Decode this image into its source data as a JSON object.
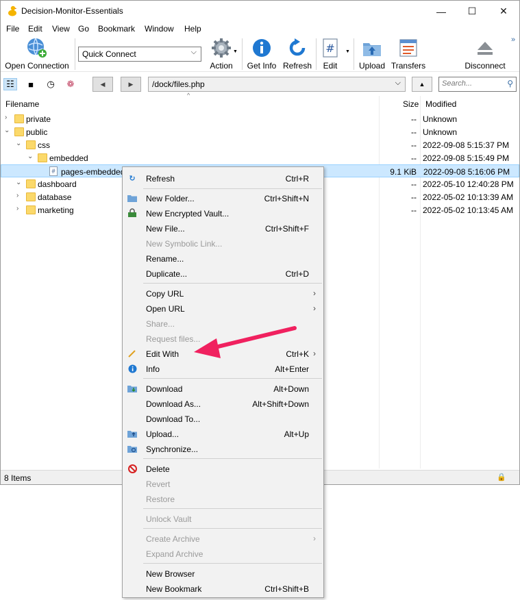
{
  "window": {
    "title": "Decision-Monitor-Essentials",
    "controls": {
      "minimize": "—",
      "maximize": "☐",
      "close": "✕"
    }
  },
  "menu": [
    "File",
    "Edit",
    "View",
    "Go",
    "Bookmark",
    "Window",
    "Help"
  ],
  "toolbar": {
    "open_connection": "Open Connection",
    "quick_connect": "Quick Connect",
    "action": "Action",
    "get_info": "Get Info",
    "refresh": "Refresh",
    "edit": "Edit",
    "upload": "Upload",
    "transfers": "Transfers",
    "disconnect": "Disconnect",
    "overflow": "»"
  },
  "nav": {
    "path": "/dock/files.php",
    "search_placeholder": "Search..."
  },
  "columns": {
    "filename": "Filename",
    "size": "Size",
    "modified": "Modified"
  },
  "files": [
    {
      "name": "private",
      "size": "--",
      "modified": "Unknown",
      "type": "folder",
      "expanded": false
    },
    {
      "name": "public",
      "size": "--",
      "modified": "Unknown",
      "type": "folder",
      "expanded": true
    },
    {
      "name": "css",
      "size": "--",
      "modified": "2022-09-08 5:15:37 PM",
      "type": "folder",
      "expanded": true
    },
    {
      "name": "embedded",
      "size": "--",
      "modified": "2022-09-08 5:15:49 PM",
      "type": "folder",
      "expanded": true
    },
    {
      "name": "pages-embedded",
      "size": "9.1 KiB",
      "modified": "2022-09-08 5:16:06 PM",
      "type": "file",
      "selected": true
    },
    {
      "name": "dashboard",
      "size": "--",
      "modified": "2022-05-10 12:40:28 PM",
      "type": "folder",
      "expanded": true
    },
    {
      "name": "database",
      "size": "--",
      "modified": "2022-05-02 10:13:39 AM",
      "type": "folder",
      "expanded": false
    },
    {
      "name": "marketing",
      "size": "--",
      "modified": "2022-05-02 10:13:45 AM",
      "type": "folder",
      "expanded": false
    }
  ],
  "status": {
    "items": "8 Items"
  },
  "context_menu": [
    {
      "label": "Refresh",
      "shortcut": "Ctrl+R",
      "icon": "refresh-icon",
      "enabled": true
    },
    {
      "label": "New Folder...",
      "shortcut": "Ctrl+Shift+N",
      "icon": "new-folder-icon",
      "enabled": true
    },
    {
      "label": "New Encrypted Vault...",
      "shortcut": "",
      "icon": "vault-icon",
      "enabled": true
    },
    {
      "label": "New File...",
      "shortcut": "Ctrl+Shift+F",
      "icon": "",
      "enabled": true
    },
    {
      "label": "New Symbolic Link...",
      "shortcut": "",
      "icon": "",
      "enabled": false
    },
    {
      "label": "Rename...",
      "shortcut": "",
      "icon": "",
      "enabled": true
    },
    {
      "label": "Duplicate...",
      "shortcut": "Ctrl+D",
      "icon": "",
      "enabled": true
    },
    {
      "label": "Copy URL",
      "shortcut": "",
      "icon": "",
      "enabled": true,
      "submenu": true
    },
    {
      "label": "Open URL",
      "shortcut": "",
      "icon": "",
      "enabled": true,
      "submenu": true
    },
    {
      "label": "Share...",
      "shortcut": "",
      "icon": "",
      "enabled": false
    },
    {
      "label": "Request files...",
      "shortcut": "",
      "icon": "",
      "enabled": false
    },
    {
      "label": "Edit With",
      "shortcut": "Ctrl+K",
      "icon": "pencil-icon",
      "enabled": true,
      "submenu": true
    },
    {
      "label": "Info",
      "shortcut": "Alt+Enter",
      "icon": "info-icon",
      "enabled": true
    },
    {
      "label": "Download",
      "shortcut": "Alt+Down",
      "icon": "download-icon",
      "enabled": true
    },
    {
      "label": "Download As...",
      "shortcut": "Alt+Shift+Down",
      "icon": "",
      "enabled": true
    },
    {
      "label": "Download To...",
      "shortcut": "",
      "icon": "",
      "enabled": true
    },
    {
      "label": "Upload...",
      "shortcut": "Alt+Up",
      "icon": "upload-icon",
      "enabled": true
    },
    {
      "label": "Synchronize...",
      "shortcut": "",
      "icon": "sync-icon",
      "enabled": true
    },
    {
      "label": "Delete",
      "shortcut": "",
      "icon": "delete-icon",
      "enabled": true
    },
    {
      "label": "Revert",
      "shortcut": "",
      "icon": "",
      "enabled": false
    },
    {
      "label": "Restore",
      "shortcut": "",
      "icon": "",
      "enabled": false
    },
    {
      "label": "Unlock Vault",
      "shortcut": "",
      "icon": "",
      "enabled": false
    },
    {
      "label": "Create Archive",
      "shortcut": "",
      "icon": "",
      "enabled": false,
      "submenu": true
    },
    {
      "label": "Expand Archive",
      "shortcut": "",
      "icon": "",
      "enabled": false
    },
    {
      "label": "New Browser",
      "shortcut": "",
      "icon": "",
      "enabled": true
    },
    {
      "label": "New Bookmark",
      "shortcut": "Ctrl+Shift+B",
      "icon": "",
      "enabled": true
    }
  ],
  "annotation": {
    "arrow_color": "#f0215f"
  }
}
